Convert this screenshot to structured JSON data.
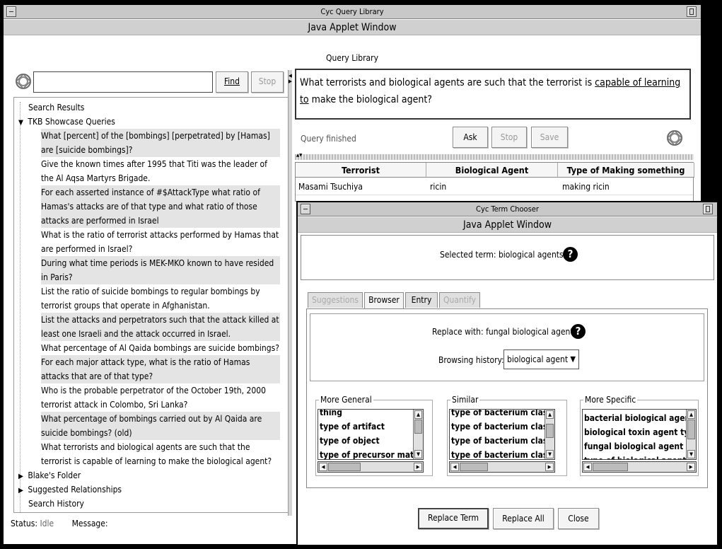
{
  "main_window": {
    "title": "Cyc Query Library",
    "subtitle": "Java Applet Window",
    "section_label": "Query Library"
  },
  "search": {
    "value": "",
    "find_label": "Find",
    "stop_label": "Stop"
  },
  "tree": {
    "search_results": "Search Results",
    "tkb_folder": "TKB Showcase Queries",
    "queries": [
      "What [percent] of the [bombings] [perpetrated] by [Hamas] are [suicide bombings]?",
      "Give the known times after 1995 that Titi was the leader of the Al Aqsa Martyrs Brigade.",
      "For each asserted instance of #$AttackType what ratio of Hamas's attacks are of that type and what ratio of those attacks are performed in Israel",
      "What is the ratio of terrorist attacks performed by Hamas that are performed in Israel?",
      "During what time periods is MEK-MKO known to have resided in Paris?",
      "List the ratio of suicide bombings to regular bombings by terrorist groups that operate in Afghanistan.",
      "List the attacks and perpetrators such that the attack killed at least one Israeli and the attack occurred in Israel.",
      "What percentage of Al Qaida bombings are suicide bombings?",
      "For each major attack type, what is the ratio of Hamas attacks that are of that type?",
      "Who is the probable perpetrator of the October 19th, 2000 terrorist attack in Colombo, Sri Lanka?",
      "What percentage of bombings carried out by Al Qaida are suicide bombings? (old)",
      "What terrorists and biological agents are such that the terrorist is capable of learning to make the biological agent?"
    ],
    "blakes_folder": "Blake's Folder",
    "suggested_relationships": "Suggested Relationships",
    "search_history": "Search History"
  },
  "status_bar": {
    "status_label": "Status:",
    "status_value": "Idle",
    "message_label": "Message:"
  },
  "query": {
    "text_before": "What terrorists and biological agents are such that the terrorist is ",
    "link_text": "capable of learning to",
    "text_after": " make the biological agent?",
    "status": "Query finished",
    "ask_label": "Ask",
    "stop_label": "Stop",
    "save_label": "Save"
  },
  "results": {
    "columns": [
      "Terrorist",
      "Biological Agent",
      "Type of Making something"
    ],
    "rows": [
      [
        "Masami Tsuchiya",
        "ricin",
        "making ricin"
      ]
    ]
  },
  "chooser": {
    "title": "Cyc Term Chooser",
    "subtitle": "Java Applet Window",
    "selected_label": "Selected term:",
    "selected_term": "biological agents",
    "tabs": [
      "Suggestions",
      "Browser",
      "Entry",
      "Quantify"
    ],
    "replace_label": "Replace with:",
    "replace_term": "fungal biological agent",
    "history_label": "Browsing history:",
    "history_value": "biological agent",
    "more_general": {
      "legend": "More General",
      "items": [
        "thing",
        "type of artifact",
        "type of object",
        "type of precursor material"
      ]
    },
    "similar": {
      "legend": "Similar",
      "items": [
        "type of bacterium classifie",
        "type of bacterium classifie",
        "type of bacterium classifie",
        "type of bacterium classifie"
      ]
    },
    "more_specific": {
      "legend": "More Specific",
      "items": [
        "bacterial biological agent t",
        "biological toxin agent type",
        "fungal biological agent",
        "type of biological agent us"
      ]
    },
    "replace_term_button": "Replace Term",
    "replace_all_button": "Replace All",
    "close_button": "Close"
  }
}
